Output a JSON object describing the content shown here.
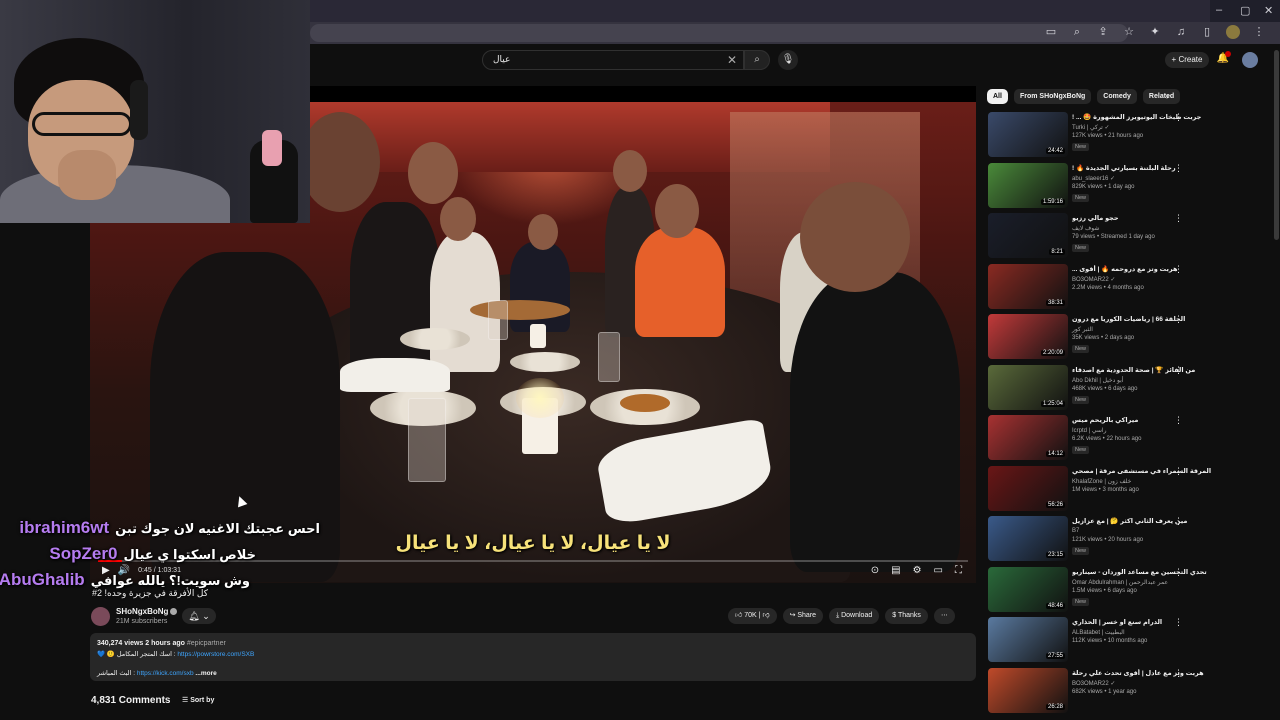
{
  "youtube": {
    "search_value": "عيال",
    "create_label": "+ Create"
  },
  "video": {
    "subtitle": "لا يا عيال، لا يا عيال، لا يا عيال",
    "progress": 0.028,
    "time": "0:45 / 1:03:31"
  },
  "chat": [
    {
      "user": "ibrahim6wt",
      "message": "احس عجبتك الاغنيه لان جوك تبن"
    },
    {
      "user": "SopZer0",
      "message": "خلاص اسكتوا ي عيال"
    },
    {
      "user": "AbuGhalib",
      "message": "وش سويت!؟ يالله عوافي"
    }
  ],
  "chat_tiny": "كل الأفرقة في جزيرة وحده! 2#",
  "channel": {
    "name": "SHoNgxBoNg",
    "subscribers": "21M subscribers"
  },
  "actions": {
    "likes": "70K",
    "share": "Share",
    "download": "Download",
    "thanks": "Thanks"
  },
  "description": {
    "stats": "340,274 views  2 hours ago",
    "tag": "#epicpartner",
    "line2_prefix": "💙 🙂 اسك المتجر المكامل : ",
    "line2_link": "https://powrstore.com/SXB",
    "line3_prefix": "البث المباشر : ",
    "line3_link": "https://kick.com/sxb",
    "more": "...more"
  },
  "comments": {
    "count": "4,831 Comments",
    "sort_label": "Sort by"
  },
  "chips": [
    "All",
    "From SHoNgxBoNg",
    "Comedy",
    "Related"
  ],
  "recommendations": [
    {
      "title": "جربت طبخات اليوتيوبرز المشهورة 🤩 ... !",
      "channel": "Turki | تركي ✓",
      "meta": "127K views • 21 hours ago",
      "badge": "New",
      "duration": "24:42",
      "color": "#3a4a6a"
    },
    {
      "title": "رحلة البلتنة بسيارتي الجديدة 🔥 !",
      "channel": "abu_slaeer16 ✓",
      "meta": "829K views • 1 day ago",
      "badge": "New",
      "duration": "1:59:16",
      "color": "#4a8a3a"
    },
    {
      "title": "حجو مالي رزيو",
      "channel": "شوف لايف",
      "meta": "79 views • Streamed 1 day ago",
      "badge": "New",
      "duration": "8:21",
      "color": "#1a1e2a"
    },
    {
      "title": "هربت وتز مع دروحمه 🔥 | أقوى ...",
      "channel": "BO3OMAR22 ✓",
      "meta": "2.2M views • 4 months ago",
      "badge": "",
      "duration": "38:31",
      "color": "#8a2a22"
    },
    {
      "title": "الحلقة 66 | رياضيات الكوريا مع درون",
      "channel": "الثبر كور",
      "meta": "35K views • 2 days ago",
      "badge": "New",
      "duration": "2:20:09",
      "color": "#c23a3a"
    },
    {
      "title": "من الفائز 🏆 | صحة الحدودية مع اصدقاء",
      "channel": "Abo Dkhil | أبو دخيل",
      "meta": "468K views • 6 days ago",
      "badge": "New",
      "duration": "1:25:04",
      "color": "#5a6a3a"
    },
    {
      "title": "ميراكي بالريحم ميس",
      "channel": "Icrptd | راسي",
      "meta": "6.2K views • 22 hours ago",
      "badge": "New",
      "duration": "14:12",
      "color": "#a83232"
    },
    {
      "title": "المرقة السمراء في مستشفى مرقة | مصحي",
      "channel": "KhalafZone | خلف زون",
      "meta": "1M views • 3 months ago",
      "badge": "",
      "duration": "56:26",
      "color": "#6a1616"
    },
    {
      "title": "مين يعرف الثاني اكثر 🤔 | مع عزازيل",
      "channel": "B7",
      "meta": "121K views • 20 hours ago",
      "badge": "New",
      "duration": "23:15",
      "color": "#3a5a8a"
    },
    {
      "title": "تحدي التحسين مع مساعد الوردان - سيناريو",
      "channel": "Omar Abdulrahman | عمر عبدالرحمن",
      "meta": "1.5M views • 6 days ago",
      "badge": "New",
      "duration": "48:46",
      "color": "#2a6a3a"
    },
    {
      "title": "الدرام سنع او خسر | الحذاري",
      "channel": "ALBatabet | البطبيت",
      "meta": "112K views • 10 months ago",
      "badge": "",
      "duration": "27:55",
      "color": "#5a7aa0"
    },
    {
      "title": "هربت وتز مع عادل | أقوى تحدث علي رحلة",
      "channel": "BO3OMAR22 ✓",
      "meta": "682K views • 1 year ago",
      "badge": "",
      "duration": "26:28",
      "color": "#c04a2a"
    }
  ]
}
